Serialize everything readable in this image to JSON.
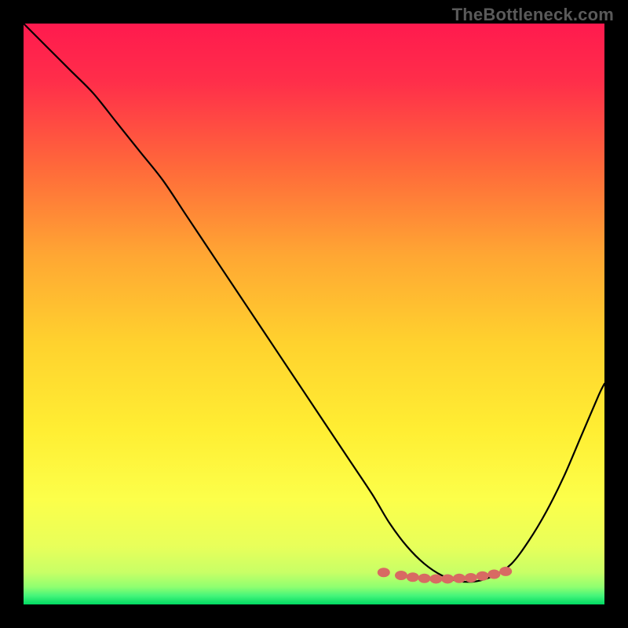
{
  "watermark": "TheBottleneck.com",
  "gradient": {
    "stops": [
      {
        "offset": 0.0,
        "color": "#ff1a4e"
      },
      {
        "offset": 0.1,
        "color": "#ff2e4a"
      },
      {
        "offset": 0.25,
        "color": "#ff6a3a"
      },
      {
        "offset": 0.4,
        "color": "#ffa733"
      },
      {
        "offset": 0.55,
        "color": "#ffd22e"
      },
      {
        "offset": 0.7,
        "color": "#ffee33"
      },
      {
        "offset": 0.82,
        "color": "#fcff4a"
      },
      {
        "offset": 0.9,
        "color": "#e8ff5a"
      },
      {
        "offset": 0.945,
        "color": "#c8ff66"
      },
      {
        "offset": 0.97,
        "color": "#8fff70"
      },
      {
        "offset": 0.985,
        "color": "#45f57a"
      },
      {
        "offset": 1.0,
        "color": "#00d963"
      }
    ]
  },
  "chart_data": {
    "type": "line",
    "title": "",
    "xlabel": "",
    "ylabel": "",
    "xlim": [
      0,
      100
    ],
    "ylim": [
      0,
      100
    ],
    "series": [
      {
        "name": "bottleneck-curve",
        "x": [
          0,
          4,
          8,
          12,
          16,
          20,
          24,
          28,
          32,
          36,
          40,
          44,
          48,
          52,
          56,
          60,
          63,
          66,
          69,
          72,
          75,
          78,
          81,
          84,
          87,
          90,
          93,
          96,
          99,
          100
        ],
        "y": [
          100,
          96,
          92,
          88,
          83,
          78,
          73,
          67,
          61,
          55,
          49,
          43,
          37,
          31,
          25,
          19,
          14,
          10,
          7,
          5,
          4,
          4,
          5,
          7,
          11,
          16,
          22,
          29,
          36,
          38
        ]
      }
    ],
    "markers": {
      "name": "bottom-dots",
      "color": "#d86a63",
      "points": [
        {
          "x": 62,
          "y": 5.5
        },
        {
          "x": 65,
          "y": 5.0
        },
        {
          "x": 67,
          "y": 4.7
        },
        {
          "x": 69,
          "y": 4.5
        },
        {
          "x": 71,
          "y": 4.4
        },
        {
          "x": 73,
          "y": 4.4
        },
        {
          "x": 75,
          "y": 4.5
        },
        {
          "x": 77,
          "y": 4.6
        },
        {
          "x": 79,
          "y": 4.9
        },
        {
          "x": 81,
          "y": 5.2
        },
        {
          "x": 83,
          "y": 5.7
        }
      ]
    }
  }
}
